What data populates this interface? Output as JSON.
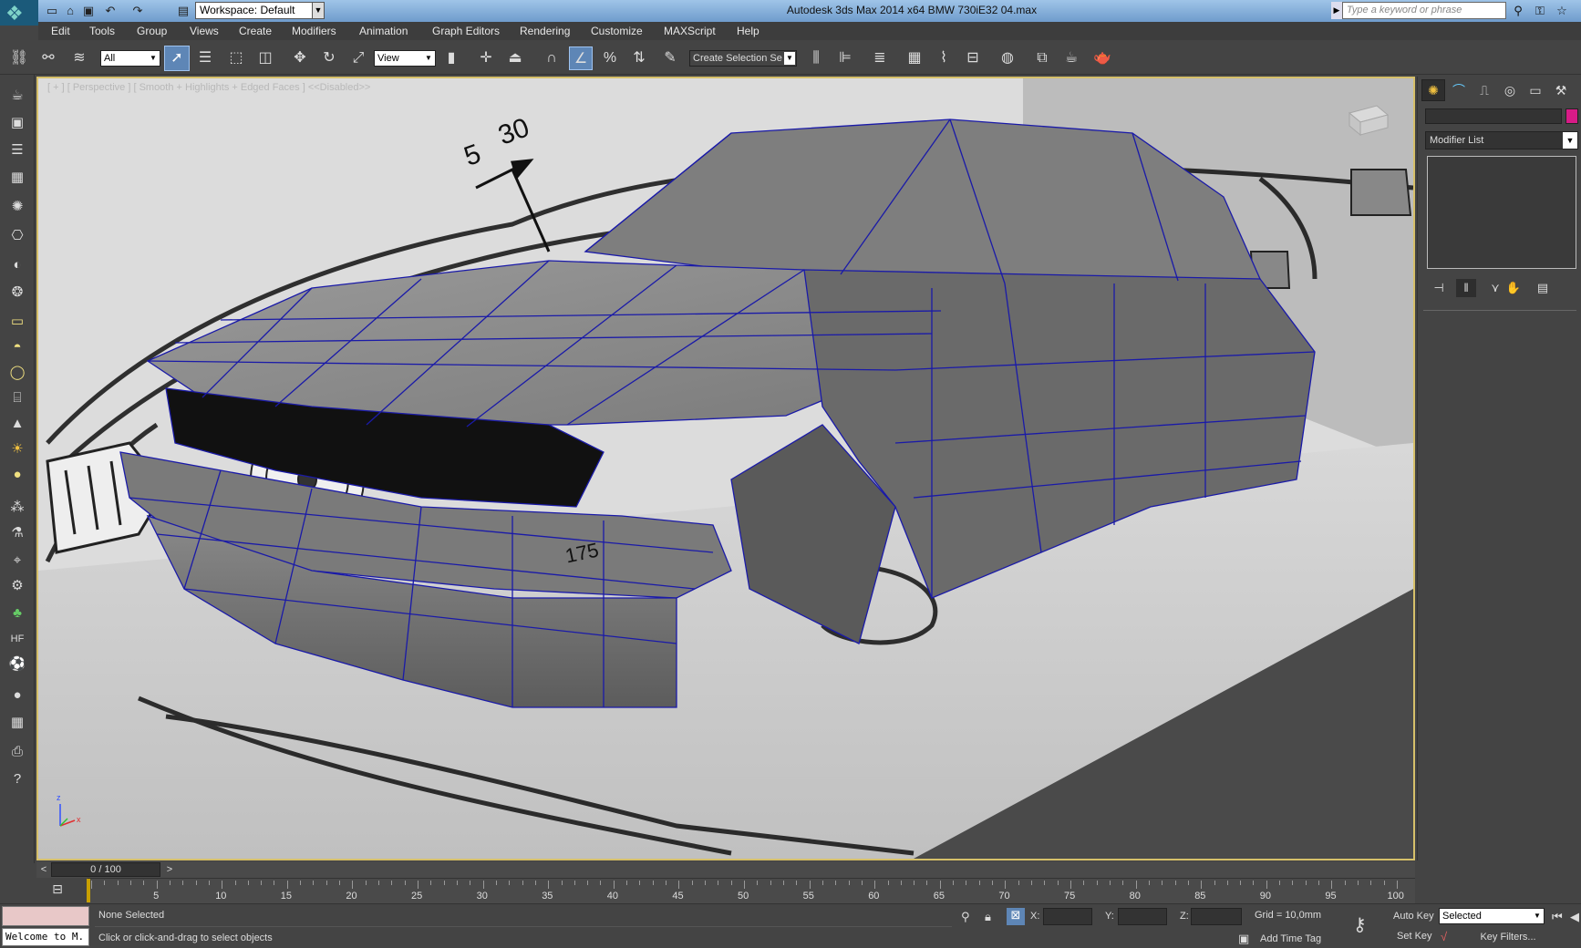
{
  "window": {
    "app_title": "Autodesk 3ds Max  2014 x64     BMW 730iE32 04.max",
    "workspace": "Workspace: Default",
    "search_placeholder": "Type a keyword or phrase"
  },
  "menu": [
    "Edit",
    "Tools",
    "Group",
    "Views",
    "Create",
    "Modifiers",
    "Animation",
    "Graph Editors",
    "Rendering",
    "Customize",
    "MAXScript",
    "Help"
  ],
  "toolbar": {
    "filter_value": "All",
    "ref_coord_value": "View",
    "named_selection_value": "Create Selection Se"
  },
  "viewport": {
    "label": "[ + ] [ Perspective ] [ Smooth + Highlights + Edged Faces ] <<Disabled>>",
    "blueprint_labels": [
      "5",
      "30",
      "175"
    ],
    "axis_labels": [
      "x",
      "z"
    ]
  },
  "command_panel": {
    "modifier_list_label": "Modifier List"
  },
  "time_slider": {
    "value": "0 / 100",
    "ticks": [
      "5",
      "10",
      "15",
      "20",
      "25",
      "30",
      "35",
      "40",
      "45",
      "50",
      "55",
      "60",
      "65",
      "70",
      "75",
      "80",
      "85",
      "90",
      "95",
      "100"
    ]
  },
  "status": {
    "maxscript_welcome": "Welcome to M.",
    "selection": "None Selected",
    "prompt": "Click or click-and-drag to select objects",
    "x_label": "X:",
    "y_label": "Y:",
    "z_label": "Z:",
    "grid": "Grid = 10,0mm",
    "add_time_tag": "Add Time Tag",
    "auto_key": "Auto Key",
    "set_key": "Set Key",
    "key_mode_value": "Selected",
    "key_filters": "Key Filters..."
  }
}
